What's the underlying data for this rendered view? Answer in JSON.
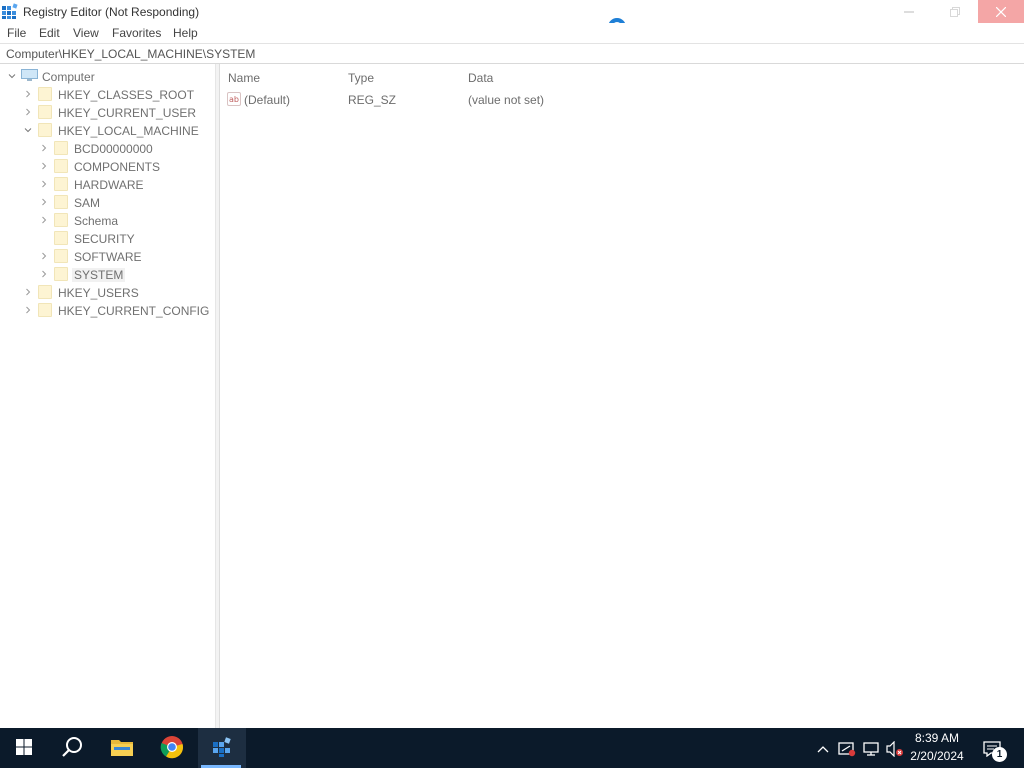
{
  "window": {
    "title": "Registry Editor (Not Responding)",
    "app_icon": "registry-editor-icon"
  },
  "menu": {
    "items": [
      "File",
      "Edit",
      "View",
      "Favorites",
      "Help"
    ]
  },
  "address": {
    "path": "Computer\\HKEY_LOCAL_MACHINE\\SYSTEM"
  },
  "tree": {
    "root": {
      "label": "Computer",
      "icon": "computer-icon",
      "expanded": true
    },
    "hives": [
      {
        "label": "HKEY_CLASSES_ROOT",
        "expanded": false
      },
      {
        "label": "HKEY_CURRENT_USER",
        "expanded": false
      },
      {
        "label": "HKEY_LOCAL_MACHINE",
        "expanded": true
      },
      {
        "label": "HKEY_USERS",
        "expanded": false
      },
      {
        "label": "HKEY_CURRENT_CONFIG",
        "expanded": false
      }
    ],
    "hklm_children": [
      {
        "label": "BCD00000000"
      },
      {
        "label": "COMPONENTS"
      },
      {
        "label": "HARDWARE"
      },
      {
        "label": "SAM"
      },
      {
        "label": "Schema"
      },
      {
        "label": "SECURITY"
      },
      {
        "label": "SOFTWARE"
      },
      {
        "label": "SYSTEM",
        "selected": true
      }
    ]
  },
  "list": {
    "columns": [
      "Name",
      "Type",
      "Data"
    ],
    "rows": [
      {
        "name": "(Default)",
        "type": "REG_SZ",
        "data": "(value not set)",
        "icon": "string-value-icon"
      }
    ]
  },
  "taskbar": {
    "pinned": [
      "start-icon",
      "search-icon",
      "file-explorer-icon",
      "chrome-icon",
      "registry-editor-icon"
    ],
    "active": "registry-editor-icon",
    "tray_icons": [
      "chevron-up-icon",
      "security-warning-icon",
      "network-icon",
      "volume-muted-icon"
    ],
    "time": "8:39 AM",
    "date": "2/20/2024",
    "notification_count": "1"
  },
  "colors": {
    "taskbar_bg": "#0b1a2a",
    "busy_spinner": "#1e7fd6",
    "close_hover": "#f4a6a6",
    "folder": "#fdf4d3"
  }
}
